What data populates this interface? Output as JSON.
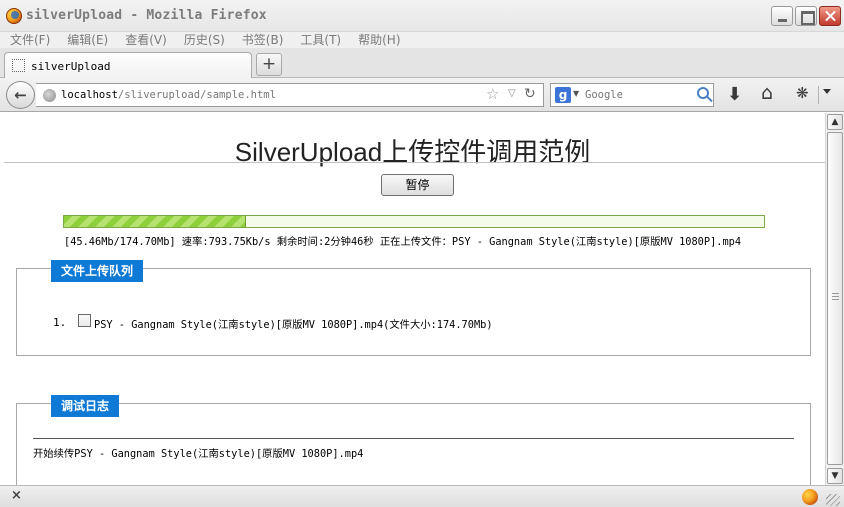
{
  "window": {
    "title": "silverUpload - Mozilla Firefox"
  },
  "menu": {
    "items": [
      "文件(F)",
      "编辑(E)",
      "查看(V)",
      "历史(S)",
      "书签(B)",
      "工具(T)",
      "帮助(H)"
    ]
  },
  "tabs": [
    {
      "label": "silverUpload",
      "favicon": "dotted-page-icon"
    }
  ],
  "newtab_label": "+",
  "navbar": {
    "url_host": "localhost",
    "url_path": "/sliverupload/sample.html",
    "search_engine": "google-icon",
    "search_placeholder": "Google"
  },
  "page": {
    "title": "SilverUpload上传控件调用范例",
    "pause_label": "暂停",
    "progress_fraction": 0.26,
    "progress_text": "[45.46Mb/174.70Mb] 速率:793.75Kb/s 剩余时间:2分钟46秒 正在上传文件：PSY - Gangnam Style(江南style)[原版MV 1080P].mp4",
    "queue": {
      "legend": "文件上传队列",
      "items": [
        {
          "index": "1.",
          "text": "PSY - Gangnam Style(江南style)[原版MV 1080P].mp4(文件大小:174.70Mb)"
        }
      ]
    },
    "log": {
      "legend": "调试日志",
      "lines": [
        "开始续传PSY - Gangnam Style(江南style)[原版MV 1080P].mp4"
      ]
    }
  },
  "statusbar": {
    "close_label": "×"
  },
  "colors": {
    "legend_bg": "#0f79d6",
    "progress_fill": "#8ed03b",
    "progress_border": "#7ea845"
  }
}
